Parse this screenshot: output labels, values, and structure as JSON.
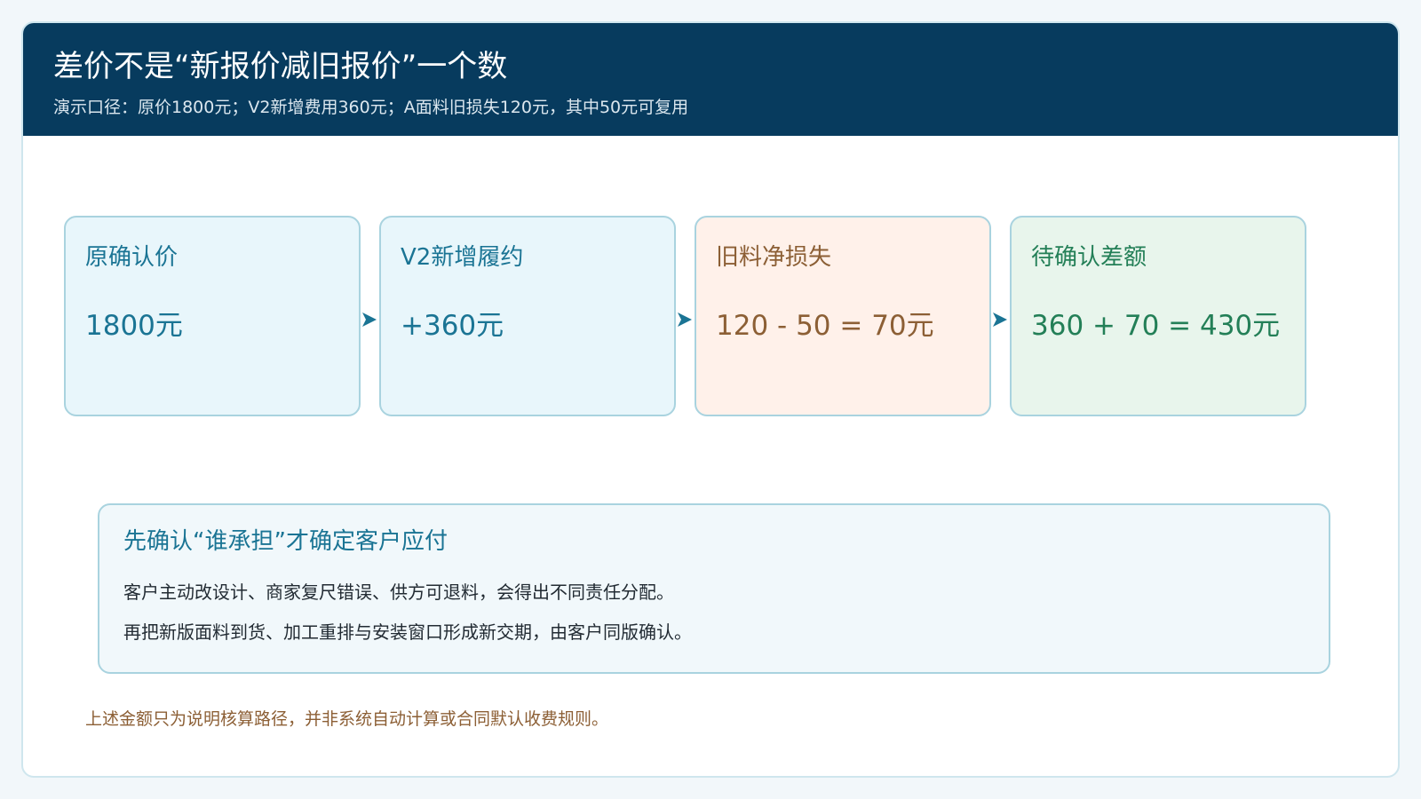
{
  "header": {
    "title": "差价不是“新报价减旧报价”一个数",
    "subtitle": "演示口径：原价1800元；V2新增费用360元；A面料旧损失120元，其中50元可复用"
  },
  "flow": {
    "steps": [
      {
        "label": "原确认价",
        "value": "1800元"
      },
      {
        "label": "V2新增履约",
        "value": "+360元"
      },
      {
        "label": "旧料净损失",
        "value": "120 - 50 = 70元"
      },
      {
        "label": "待确认差额",
        "value": "360 + 70 = 430元"
      }
    ]
  },
  "note": {
    "title": "先确认“谁承担”才确定客户应付",
    "lines": [
      "客户主动改设计、商家复尺错误、供方可退料，会得出不同责任分配。",
      "再把新版面料到货、加工重排与安装窗口形成新交期，由客户同版确认。"
    ]
  },
  "footer": {
    "disclaimer": "上述金额只为说明核算路径，并非系统自动计算或合同默认收费规则。"
  },
  "colors": {
    "header_bg": "#073b5e",
    "accent_blue": "#1a7494",
    "accent_brown": "#8c5f35",
    "accent_green": "#237f57",
    "border": "#a9d3df"
  }
}
